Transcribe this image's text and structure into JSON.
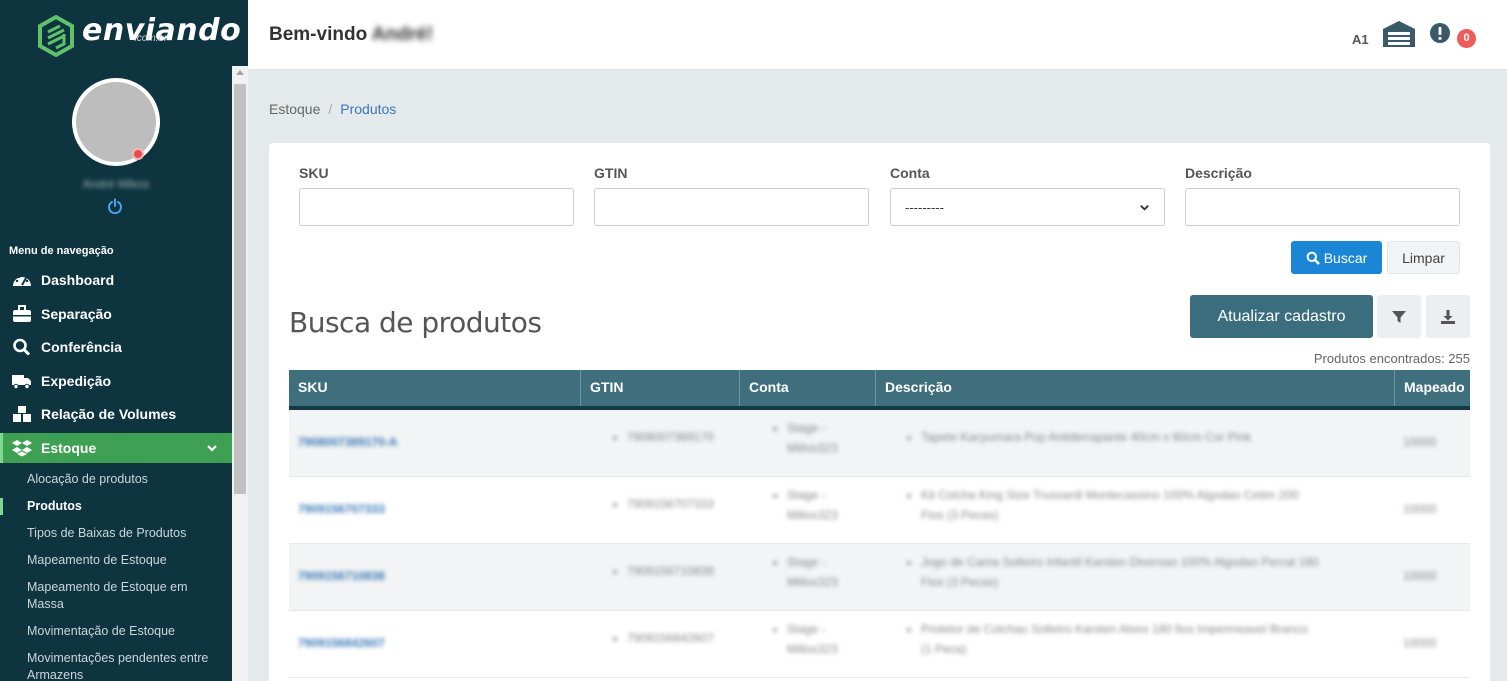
{
  "brand": {
    "name": "enviando",
    "sub": ".com.br"
  },
  "user": {
    "name": "André Mikos"
  },
  "nav": {
    "heading": "Menu de navegação",
    "items": [
      {
        "label": "Dashboard",
        "icon": "tachometer-icon"
      },
      {
        "label": "Separação",
        "icon": "briefcase-icon"
      },
      {
        "label": "Conferência",
        "icon": "search-icon"
      },
      {
        "label": "Expedição",
        "icon": "truck-icon"
      },
      {
        "label": "Relação de Volumes",
        "icon": "cubes-icon"
      },
      {
        "label": "Estoque",
        "icon": "dropbox-icon"
      }
    ],
    "subitems": [
      "Alocação de produtos",
      "Produtos",
      "Tipos de Baixas de Produtos",
      "Mapeamento de Estoque",
      "Mapeamento de Estoque em Massa",
      "Movimentação de Estoque",
      "Movimentações pendentes entre Armazens"
    ]
  },
  "header": {
    "welcome": "Bem-vindo",
    "welcome_name": "André!",
    "warehouse_code": "A1",
    "alert_count": "0"
  },
  "breadcrumb": {
    "root": "Estoque",
    "current": "Produtos"
  },
  "filters": {
    "sku_label": "SKU",
    "gtin_label": "GTIN",
    "conta_label": "Conta",
    "conta_value": "---------",
    "descricao_label": "Descrição",
    "buscar": "Buscar",
    "limpar": "Limpar"
  },
  "results": {
    "title": "Busca de produtos",
    "update_button": "Atualizar cadastro",
    "found": "Produtos encontrados: 255",
    "columns": [
      "SKU",
      "GTIN",
      "Conta",
      "Descrição",
      "Mapeado"
    ],
    "rows": [
      {
        "sku": "7908007389170-A",
        "gtin": "7908007389170",
        "conta1": "Stage -",
        "conta2": "Millos323",
        "desc1": "Tapete Kacyumara Pop Antiderrapante 40cm x 60cm Cor Pink",
        "desc2": "",
        "mapeado": "10000"
      },
      {
        "sku": "7909156707333",
        "gtin": "7909156707333",
        "conta1": "Stage -",
        "conta2": "Millos323",
        "desc1": "Kit Colcha King Size Trussardi Montecassino 100% Algodao Cetim 200",
        "desc2": "Fios (3 Pecas)",
        "mapeado": "10000"
      },
      {
        "sku": "7909156710838",
        "gtin": "7909156710838",
        "conta1": "Stage -",
        "conta2": "Millos323",
        "desc1": "Jogo de Cama Solteiro Infantil Karsten Diversao 100% Algodao Percal 180",
        "desc2": "Fios (3 Pecas)",
        "mapeado": "10000"
      },
      {
        "sku": "7909156842607",
        "gtin": "7909156842607",
        "conta1": "Stage -",
        "conta2": "Millos323",
        "desc1": "Protetor de Colchao Solteiro Karsten Alves 180 fios Impermeavel Branco",
        "desc2": "(1 Peca)",
        "mapeado": "10000"
      }
    ]
  },
  "colors": {
    "sidebar": "#0e3440",
    "active": "#3ea053",
    "table_header": "#3f6f7d",
    "primary": "#1c86d6",
    "badge": "#f05a5a"
  }
}
